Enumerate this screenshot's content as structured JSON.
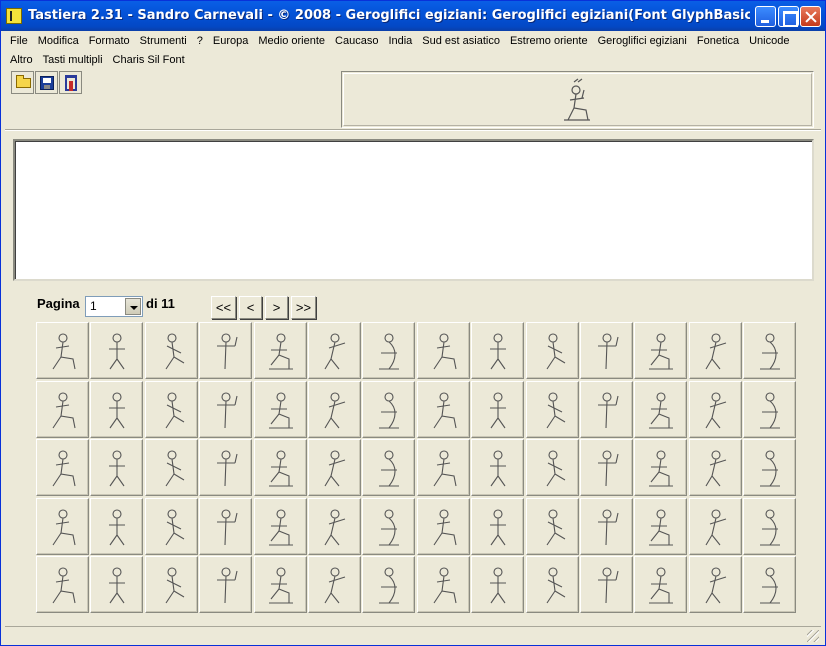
{
  "window": {
    "title": "Tastiera 2.31 - Sandro Carnevali - ©  2008 - Geroglifici egiziani: Geroglifici egiziani(Font GlyphBasic - Hint = Codi..."
  },
  "menu": {
    "row1": [
      "File",
      "Modifica",
      "Formato",
      "Strumenti",
      "?",
      "Europa",
      "Medio oriente",
      "Caucaso",
      "India",
      "Sud est asiatico",
      "Estremo oriente",
      "Geroglifici egiziani",
      "Fonetica",
      "Unicode"
    ],
    "row2": [
      "Altro",
      "Tasti multipli",
      "Charis Sil Font"
    ]
  },
  "toolbar": {
    "icons": [
      "open-folder-icon",
      "save-floppy-icon",
      "exit-door-icon"
    ]
  },
  "editor": {
    "text": ""
  },
  "pager": {
    "label": "Pagina",
    "current": "1",
    "of_text": "di 11",
    "first": "<<",
    "prev": "<",
    "next": ">",
    "last": ">>"
  },
  "glyph_grid": {
    "rows": 5,
    "cols": 14,
    "icon": "hieroglyph-icon"
  },
  "colors": {
    "titlebar": "#0453d8",
    "face": "#ece9d8",
    "glyph_stroke": "#555555"
  }
}
